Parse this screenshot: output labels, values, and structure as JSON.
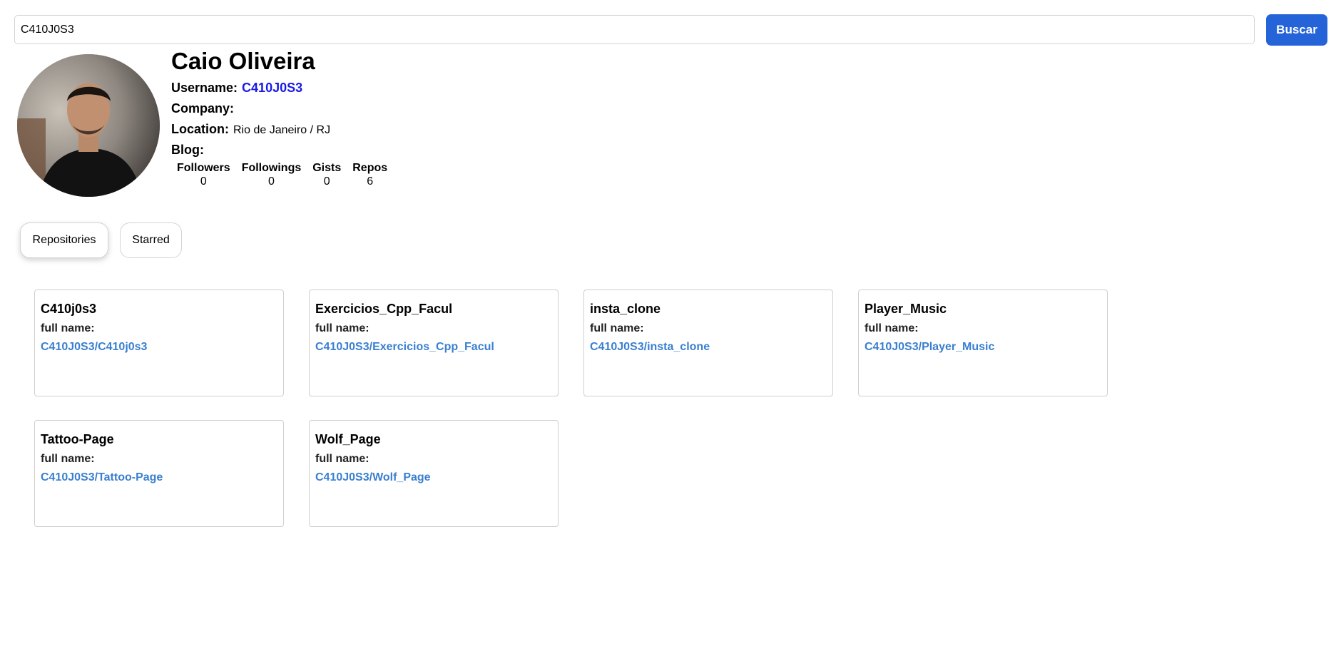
{
  "search": {
    "value": "C410J0S3",
    "button_label": "Buscar"
  },
  "profile": {
    "name": "Caio Oliveira",
    "username_label": "Username:",
    "username": "C410J0S3",
    "company_label": "Company:",
    "company": "",
    "location_label": "Location:",
    "location": "Rio de Janeiro / RJ",
    "blog_label": "Blog:",
    "blog": ""
  },
  "stats": [
    {
      "label": "Followers",
      "value": "0"
    },
    {
      "label": "Followings",
      "value": "0"
    },
    {
      "label": "Gists",
      "value": "0"
    },
    {
      "label": "Repos",
      "value": "6"
    }
  ],
  "tabs": [
    {
      "label": "Repositories",
      "active": true
    },
    {
      "label": "Starred",
      "active": false
    }
  ],
  "repos": [
    {
      "name": "C410j0s3",
      "full_name_label": "full name:",
      "full_name": "C410J0S3/C410j0s3"
    },
    {
      "name": "Exercicios_Cpp_Facul",
      "full_name_label": "full name:",
      "full_name": "C410J0S3/Exercicios_Cpp_Facul"
    },
    {
      "name": "insta_clone",
      "full_name_label": "full name:",
      "full_name": "C410J0S3/insta_clone"
    },
    {
      "name": "Player_Music",
      "full_name_label": "full name:",
      "full_name": "C410J0S3/Player_Music"
    },
    {
      "name": "Tattoo-Page",
      "full_name_label": "full name:",
      "full_name": "C410J0S3/Tattoo-Page"
    },
    {
      "name": "Wolf_Page",
      "full_name_label": "full name:",
      "full_name": "C410J0S3/Wolf_Page"
    }
  ],
  "colors": {
    "accent": "#2563d8",
    "username_link": "#1a1ae6",
    "repo_link": "#3a7fd0"
  }
}
